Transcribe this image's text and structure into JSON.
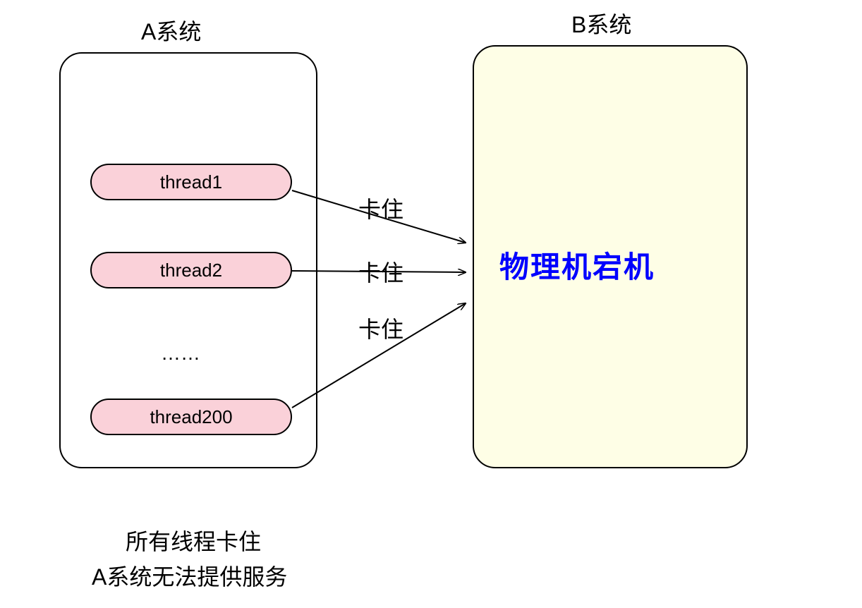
{
  "titles": {
    "systemA": "A系统",
    "systemB": "B系统"
  },
  "systemA": {
    "threads": [
      "thread1",
      "thread2",
      "thread200"
    ],
    "ellipsis": "……"
  },
  "systemB": {
    "status": "物理机宕机"
  },
  "arrows": {
    "label1": "卡住",
    "label2": "卡住",
    "label3": "卡住"
  },
  "caption": {
    "line1": "所有线程卡住",
    "line2": "A系统无法提供服务"
  },
  "colors": {
    "threadFill": "#FAD1D9",
    "systemBFill": "#FEFEE6",
    "crashedText": "#0000FE"
  }
}
